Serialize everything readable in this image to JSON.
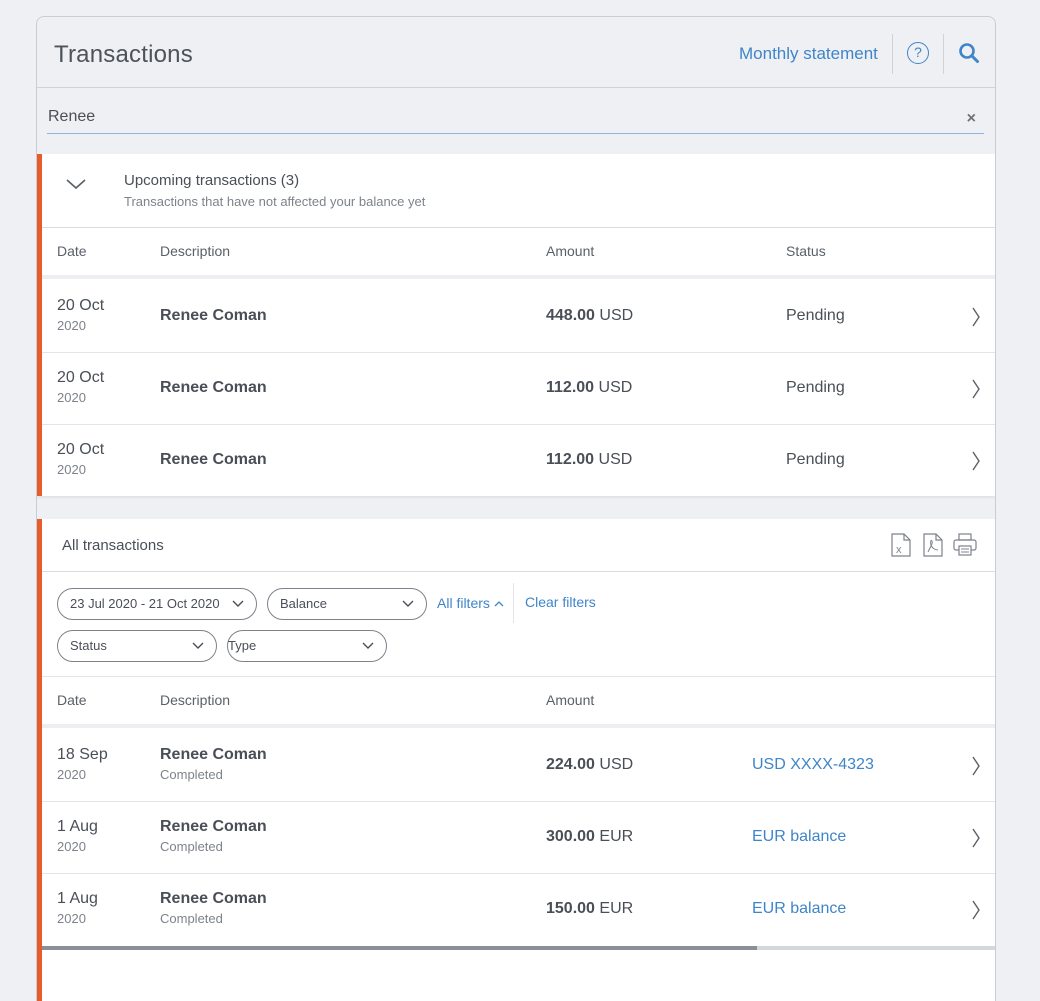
{
  "header": {
    "title": "Transactions",
    "monthly_statement": "Monthly statement",
    "help_glyph": "?"
  },
  "search": {
    "value": "Renee",
    "clear_glyph": "×"
  },
  "upcoming": {
    "title": "Upcoming transactions (3)",
    "subtitle": "Transactions that have not affected your balance yet",
    "columns": {
      "date": "Date",
      "description": "Description",
      "amount": "Amount",
      "status": "Status"
    },
    "rows": [
      {
        "day": "20 Oct",
        "year": "2020",
        "description": "Renee Coman",
        "amount": "448.00",
        "currency": "USD",
        "status": "Pending"
      },
      {
        "day": "20 Oct",
        "year": "2020",
        "description": "Renee Coman",
        "amount": "112.00",
        "currency": "USD",
        "status": "Pending"
      },
      {
        "day": "20 Oct",
        "year": "2020",
        "description": "Renee Coman",
        "amount": "112.00",
        "currency": "USD",
        "status": "Pending"
      }
    ]
  },
  "all": {
    "title": "All transactions",
    "tools": [
      "excel-export-icon",
      "pdf-export-icon",
      "print-icon"
    ],
    "filters": {
      "date_range": "23 Jul 2020 - 21 Oct 2020",
      "balance": "Balance",
      "all_filters": "All filters",
      "clear_filters": "Clear filters",
      "status": "Status",
      "type": "Type"
    },
    "columns": {
      "date": "Date",
      "description": "Description",
      "amount": "Amount"
    },
    "rows": [
      {
        "day": "18 Sep",
        "year": "2020",
        "description": "Renee Coman",
        "state": "Completed",
        "amount": "224.00",
        "currency": "USD",
        "account": "USD XXXX-4323"
      },
      {
        "day": "1 Aug",
        "year": "2020",
        "description": "Renee Coman",
        "state": "Completed",
        "amount": "300.00",
        "currency": "EUR",
        "account": "EUR balance"
      },
      {
        "day": "1 Aug",
        "year": "2020",
        "description": "Renee Coman",
        "state": "Completed",
        "amount": "150.00",
        "currency": "EUR",
        "account": "EUR balance"
      }
    ],
    "scroll_position": 0.75
  },
  "colors": {
    "accent": "#3f85c9",
    "stripe": "#e85c2c",
    "text": "#4a4f57",
    "muted": "#7d838b",
    "background": "#eef0f3"
  }
}
